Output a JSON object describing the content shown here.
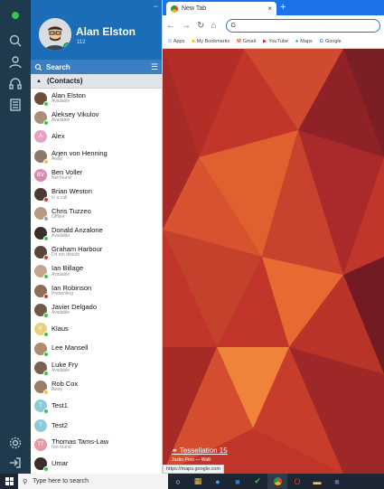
{
  "user": {
    "name": "Alan Elston",
    "extension": "112"
  },
  "search": {
    "label": "Search"
  },
  "group": {
    "label": "(Contacts)"
  },
  "contacts": [
    {
      "name": "Alan Elston",
      "status": "Available",
      "color": "#2ecc40",
      "av": "#6b4d3a"
    },
    {
      "name": "Aleksey Vikulov",
      "status": "Available",
      "color": "#2ecc40",
      "av": "#a88f7c"
    },
    {
      "name": "Alex",
      "status": "",
      "color": "",
      "av": "#e7a1c6",
      "initial": "A"
    },
    {
      "name": "Arjen von Henning",
      "status": "Away",
      "color": "#f5c542",
      "av": "#8b7a6a"
    },
    {
      "name": "Ben Voller",
      "status": "Not found",
      "color": "",
      "av": "#d98ab0",
      "initial": "BV"
    },
    {
      "name": "Brian Weston",
      "status": "In a call",
      "color": "#e8312f",
      "av": "#4a3a32"
    },
    {
      "name": "Chris Tuzzeo",
      "status": "Offline",
      "color": "#9aa0a6",
      "av": "#b59a84"
    },
    {
      "name": "Donald Anzalone",
      "status": "Available",
      "color": "#2ecc40",
      "av": "#3b2e28"
    },
    {
      "name": "Graham Harbour",
      "status": "Do not disturb",
      "color": "#e8312f",
      "av": "#5a4638"
    },
    {
      "name": "Ian Billage",
      "status": "Available",
      "color": "#2ecc40",
      "av": "#c4a68e"
    },
    {
      "name": "Ian Robinson",
      "status": "Presenting",
      "color": "#e8312f",
      "av": "#8c6e58"
    },
    {
      "name": "Javier Delgado",
      "status": "Available",
      "color": "#2ecc40",
      "av": "#6f5a48"
    },
    {
      "name": "Klaus",
      "status": "",
      "color": "#2ecc40",
      "av": "#e8d17a",
      "initial": "K"
    },
    {
      "name": "Lee Mansell",
      "status": "",
      "color": "#2ecc40",
      "av": "#b08a6c"
    },
    {
      "name": "Luke Fry",
      "status": "Available",
      "color": "#2ecc40",
      "av": "#7a624e"
    },
    {
      "name": "Rob Cox",
      "status": "Away",
      "color": "#f5c542",
      "av": "#9b7c66"
    },
    {
      "name": "Test1",
      "status": "",
      "color": "#2ecc40",
      "av": "#8ecbd9",
      "initial": "T"
    },
    {
      "name": "Test2",
      "status": "",
      "color": "",
      "av": "#8ecbd9",
      "initial": "T"
    },
    {
      "name": "Thomas Tams-Law",
      "status": "Not found",
      "color": "",
      "av": "#e79aa6",
      "initial": "TT"
    },
    {
      "name": "Umar",
      "status": "",
      "color": "#2ecc40",
      "av": "#3b2e28"
    }
  ],
  "browser": {
    "tab_title": "New Tab",
    "omnibox_value": "G",
    "bookmarks": [
      "Apps",
      "My Bookmarks",
      "Gmail",
      "YouTube",
      "Maps",
      "Google"
    ],
    "background_title": "Tessellation 15",
    "background_author": "Justin Prno — Walli",
    "status_url": "https://maps.google.com"
  },
  "taskbar": {
    "search_placeholder": "Type here to search"
  }
}
